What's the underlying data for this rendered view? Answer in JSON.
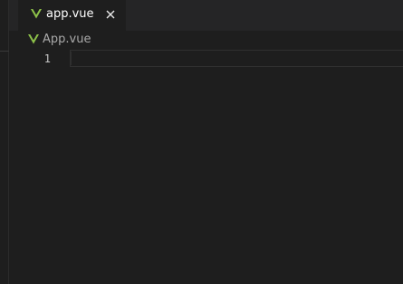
{
  "tab": {
    "label": "app.vue",
    "close_glyph": "✕",
    "icon": "vue-icon",
    "active": true
  },
  "breadcrumb": {
    "label": "App.vue",
    "icon": "vue-icon"
  },
  "editor": {
    "line_numbers": [
      "1"
    ],
    "lines": [
      ""
    ]
  },
  "colors": {
    "background": "#1e1e1e",
    "tab_bar": "#252526",
    "vue_green_light": "#41b883",
    "vue_green_dark": "#35495e",
    "tab_text": "#ffffff",
    "breadcrumb_text": "#a9a9a9",
    "line_number": "#c6c6c6"
  }
}
